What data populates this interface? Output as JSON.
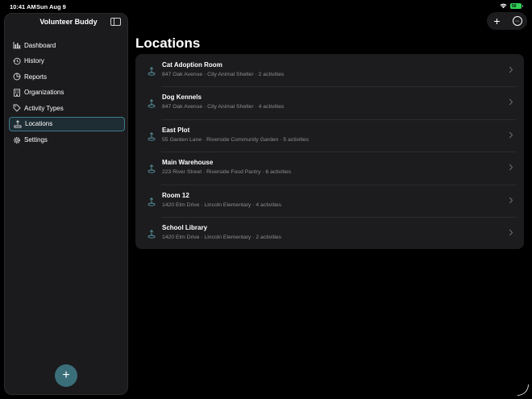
{
  "status": {
    "time": "10:41 AM",
    "date": "Sun Aug 9",
    "battery": "50"
  },
  "sidebar": {
    "title": "Volunteer Buddy",
    "items": [
      {
        "label": "Dashboard",
        "icon": "chart-bar-icon",
        "active": false
      },
      {
        "label": "History",
        "icon": "clock-history-icon",
        "active": false
      },
      {
        "label": "Reports",
        "icon": "report-icon",
        "active": false
      },
      {
        "label": "Organizations",
        "icon": "building-icon",
        "active": false
      },
      {
        "label": "Activity Types",
        "icon": "tag-icon",
        "active": false
      },
      {
        "label": "Locations",
        "icon": "location-pin-icon",
        "active": true
      },
      {
        "label": "Settings",
        "icon": "gear-icon",
        "active": false
      }
    ],
    "add_label": "+"
  },
  "toolbar": {
    "add_label": "+",
    "more_label": "···"
  },
  "main": {
    "title": "Locations",
    "locations": [
      {
        "name": "Cat Adoption Room",
        "detail": "847 Oak Avenue · City Animal Shelter · 2 activities"
      },
      {
        "name": "Dog Kennels",
        "detail": "847 Oak Avenue · City Animal Shelter · 4 activities"
      },
      {
        "name": "East Plot",
        "detail": "55 Garden Lane · Riverside Community Garden · 5 activities"
      },
      {
        "name": "Main Warehouse",
        "detail": "223 River Street · Riverside Food Pantry · 6 activities"
      },
      {
        "name": "Room 12",
        "detail": "1420 Elm Drive · Lincoln Elementary · 4 activities"
      },
      {
        "name": "School Library",
        "detail": "1420 Elm Drive · Lincoln Elementary · 2 activities"
      }
    ]
  },
  "colors": {
    "accent": "#3a6f7a",
    "active_border": "#3d7a8c",
    "battery": "#30d158"
  }
}
